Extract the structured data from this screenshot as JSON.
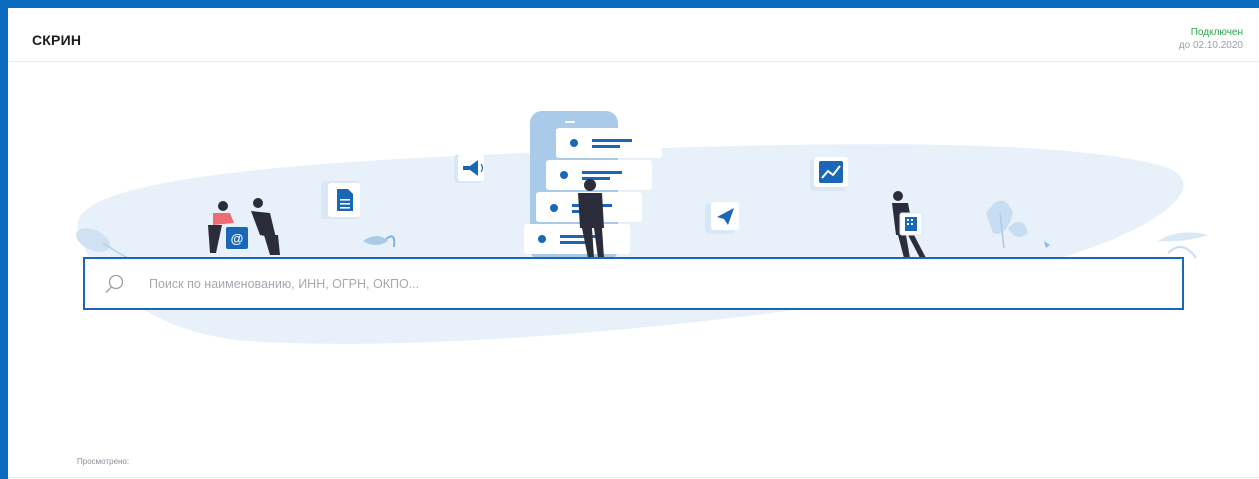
{
  "header": {
    "title": "СКРИН",
    "status": "Подключен",
    "valid_until": "до 02.10.2020"
  },
  "search": {
    "placeholder": "Поиск по наименованию, ИНН, ОГРН, ОКПО..."
  },
  "footer": {
    "viewed_label": "Просмотрено:"
  },
  "colors": {
    "accent": "#0a6bc0",
    "status_connected": "#2ea44f",
    "illustration_bg": "#e8f1fa",
    "icon_blue": "#1a67b8"
  },
  "illustration": {
    "icons": [
      "email-icon",
      "document-icon",
      "megaphone-icon",
      "paper-plane-icon",
      "chart-icon",
      "building-icon"
    ]
  }
}
